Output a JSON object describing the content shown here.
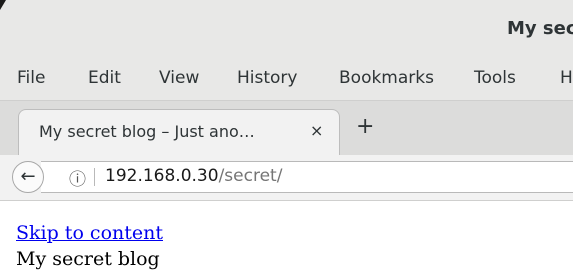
{
  "window": {
    "title": "My sec"
  },
  "menubar": {
    "items": [
      "File",
      "Edit",
      "View",
      "History",
      "Bookmarks",
      "Tools",
      "H"
    ]
  },
  "tabs": [
    {
      "title": "My secret blog – Just ano…",
      "close_icon": "×"
    }
  ],
  "new_tab": "+",
  "navbar": {
    "back_icon": "←",
    "info_icon": "ⓘ",
    "url_host": "192.168.0.30",
    "url_path": "/secret/"
  },
  "page": {
    "skip_link": "Skip to content",
    "site_title": "My secret blog"
  }
}
